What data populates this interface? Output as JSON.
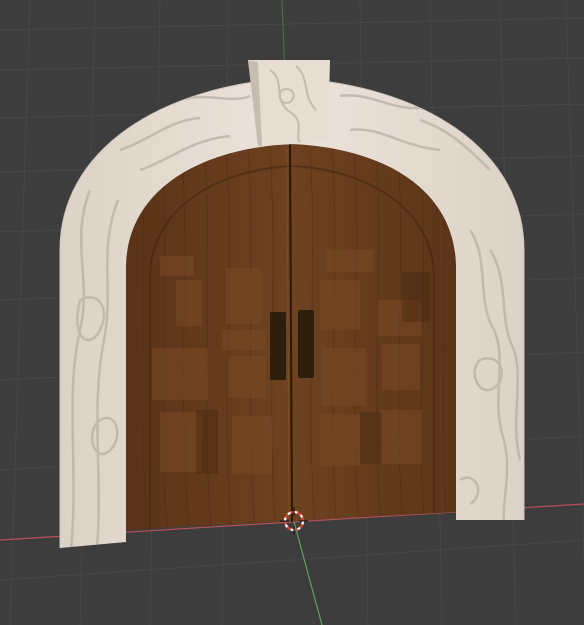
{
  "viewport": {
    "background_color": "#3d3d3d",
    "grid_color": "#4a4a4a",
    "x_axis_color": "#b8505a",
    "y_axis_color": "#5fa35f"
  },
  "model": {
    "name": "arched-double-door",
    "arch_material_color": "#e6dbd1",
    "arch_grain_color": "#b9aca1",
    "door_wood_color": "#6b3f1f",
    "door_wood_dark": "#4a2a13",
    "handle_color": "#2e1e0e"
  },
  "cursor": {
    "icon": "3d-cursor-icon",
    "ring_color_primary": "#e0402f",
    "ring_color_secondary": "#ffffff"
  }
}
